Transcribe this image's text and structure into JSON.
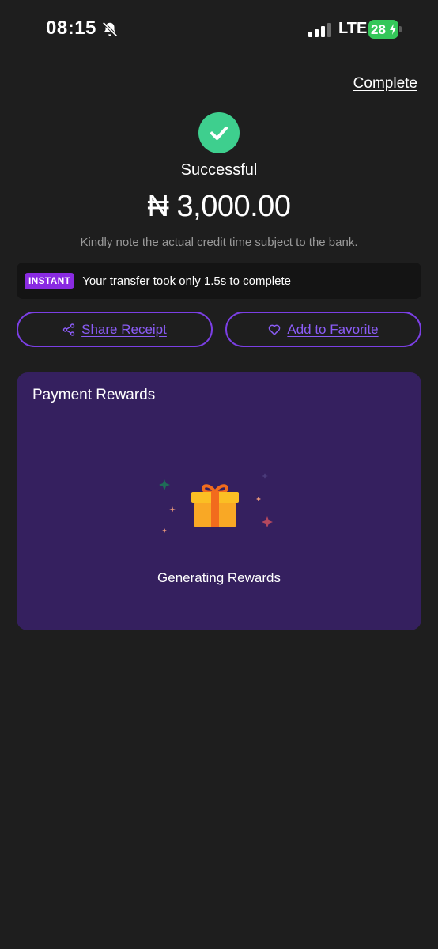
{
  "status_bar": {
    "time": "08:15",
    "network": "LTE",
    "battery": "28"
  },
  "header": {
    "complete_label": "Complete"
  },
  "result": {
    "status": "Successful",
    "amount": "₦ 3,000.00",
    "note": "Kindly note the actual credit time subject to the bank."
  },
  "instant": {
    "badge": "INSTANT",
    "message": "Your transfer took only 1.5s to complete"
  },
  "actions": {
    "share_label": "Share Receipt",
    "favorite_label": "Add to Favorite"
  },
  "rewards": {
    "title": "Payment Rewards",
    "status": "Generating Rewards"
  },
  "colors": {
    "background": "#1e1e1e",
    "success": "#3ecf8e",
    "accent": "#8b5cf6",
    "card": "#35205f",
    "badge": "#8a2be2"
  }
}
